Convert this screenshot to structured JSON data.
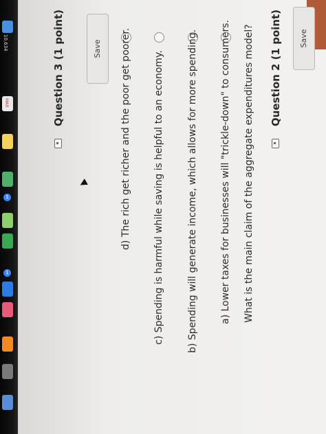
{
  "colors": {
    "accent": "#b15a3a",
    "page_bg": "#f0efed",
    "text": "#2c2c2c",
    "dock_bg": "#0d0d0d"
  },
  "dock": {
    "badge_count": "10,634",
    "calendar_month": "MAR",
    "calendar_badge": "1",
    "reminders_badge": "1",
    "icons": [
      "mail-icon",
      "calendar-icon",
      "notes-icon",
      "maps-icon",
      "photos-icon",
      "messages-icon",
      "app-store-icon",
      "music-icon",
      "books-icon",
      "settings-icon"
    ]
  },
  "quiz": {
    "top_save_label": "Save",
    "question2": {
      "heading": "Question 2 (1 point)",
      "prompt": "What is the main claim of the aggregate expenditures model?",
      "options": [
        "a) Lower taxes for businesses will \"trickle-down\" to consumers.",
        "b) Spending will generate income, which allows for more spending.",
        "c) Spending is harmful while saving is helpful to an economy.",
        "d) The rich get richer and the poor get poorer."
      ],
      "save_label": "Save"
    },
    "question3": {
      "heading": "Question 3 (1 point)"
    }
  }
}
